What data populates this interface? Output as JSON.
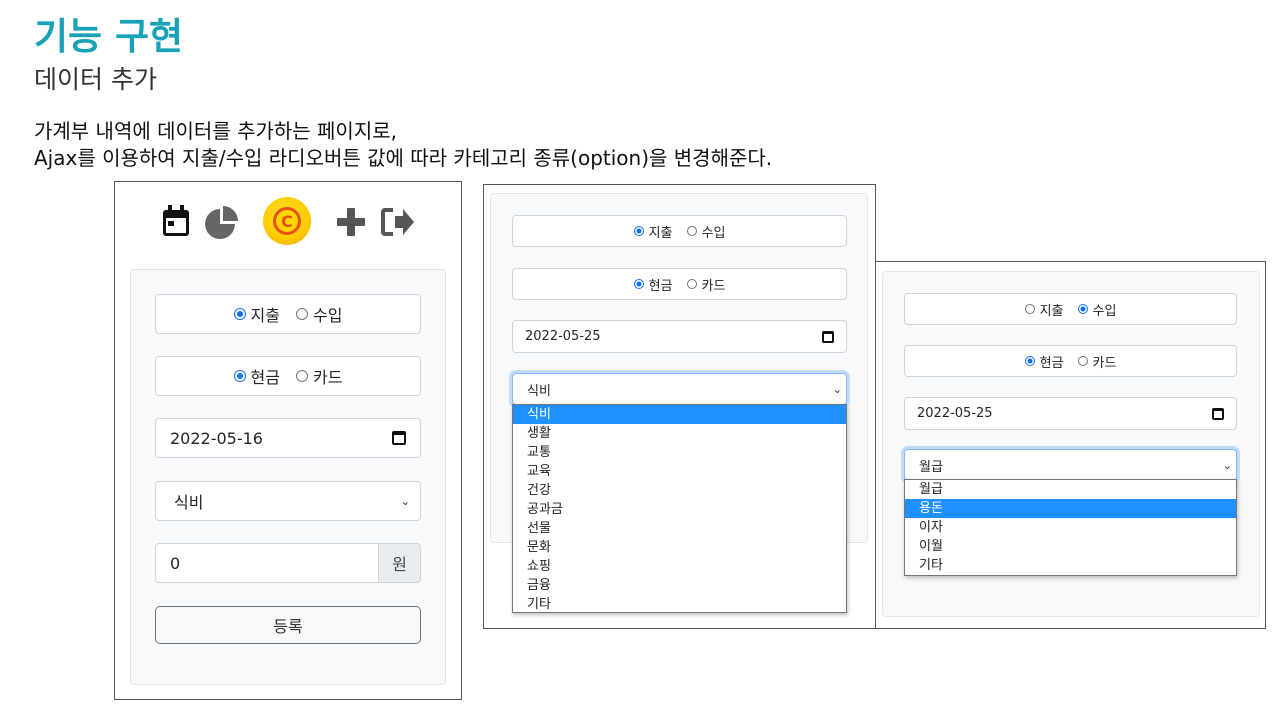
{
  "slide": {
    "title": "기능 구현",
    "subtitle": "데이터 추가",
    "description_line1": "가계부 내역에 데이터를 추가하는 페이지로,",
    "description_line2": "Ajax를 이용하여 지출/수입 라디오버튼 값에 따라 카테고리 종류(option)을 변경해준다."
  },
  "colors": {
    "title": "#17a2b8",
    "radio_checked": "#0d6efd",
    "dropdown_selected": "#1e90ff"
  },
  "shot1": {
    "nav_icons": [
      "calendar-icon",
      "pie-chart-icon",
      "coin-logo",
      "plus-icon",
      "logout-icon"
    ],
    "type_expense": "지출",
    "type_income": "수입",
    "type_selected": "expense",
    "pay_cash": "현금",
    "pay_card": "카드",
    "pay_selected": "cash",
    "date": "2022-05-16",
    "category": "식비",
    "amount": "0",
    "amount_unit": "원",
    "submit_label": "등록"
  },
  "shot2": {
    "type_expense": "지출",
    "type_income": "수입",
    "type_selected": "expense",
    "pay_cash": "현금",
    "pay_card": "카드",
    "pay_selected": "cash",
    "date": "2022-05-25",
    "category": "식비",
    "options": [
      "식비",
      "생활",
      "교통",
      "교육",
      "건강",
      "공과금",
      "선물",
      "문화",
      "쇼핑",
      "금융",
      "기타"
    ],
    "selected_option": "식비"
  },
  "shot3": {
    "type_expense": "지출",
    "type_income": "수입",
    "type_selected": "income",
    "pay_cash": "현금",
    "pay_card": "카드",
    "pay_selected": "cash",
    "date": "2022-05-25",
    "category": "월급",
    "options": [
      "월급",
      "용돈",
      "이자",
      "이월",
      "기타"
    ],
    "selected_option": "용돈"
  }
}
